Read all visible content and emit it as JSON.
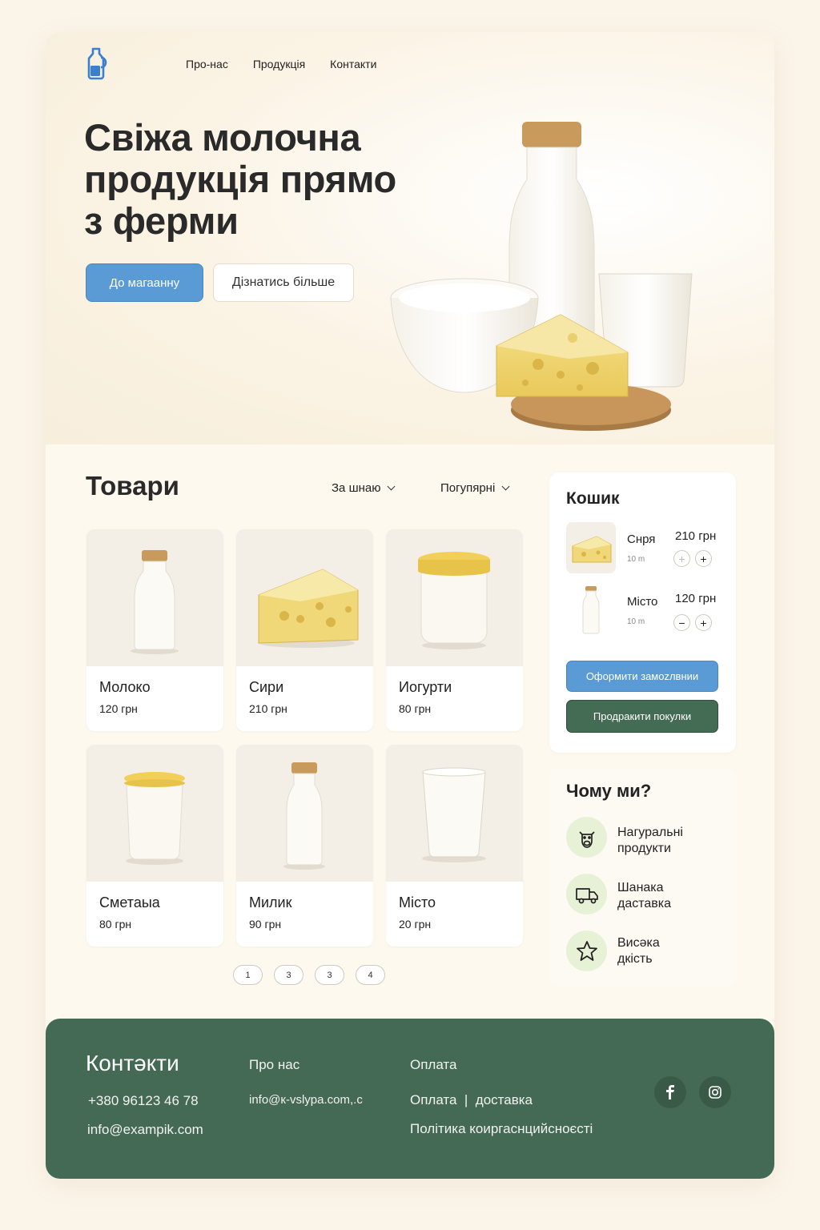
{
  "nav": {
    "items": [
      "Про-нас",
      "Продукція",
      "Контакти"
    ]
  },
  "hero": {
    "title_lines": [
      "Свіжа молочна",
      "продукція прямо",
      "з ферми"
    ],
    "primary_button": "До магаанну",
    "secondary_button": "Дізнатись більше"
  },
  "products": {
    "title": "Товари",
    "sort_price": "За шнаю",
    "sort_popular": "Погупярні",
    "items": [
      {
        "name": "Молоко",
        "price": "120 грн",
        "icon": "milk-bottle"
      },
      {
        "name": "Сири",
        "price": "210 грн",
        "icon": "cheese"
      },
      {
        "name": "Иогурти",
        "price": "80 грн",
        "icon": "yogurt-jar"
      },
      {
        "name": "Сметаыа",
        "price": "80 грн",
        "icon": "sour-cream-cup"
      },
      {
        "name": "Милик",
        "price": "90 грн",
        "icon": "milk-bottle"
      },
      {
        "name": "Місто",
        "price": "20 грн",
        "icon": "milk-glass"
      }
    ],
    "pages": [
      "1",
      "3",
      "3",
      "4"
    ]
  },
  "cart": {
    "title": "Кошик",
    "items": [
      {
        "name": "Снря",
        "sub": "10 m",
        "price": "210 грн",
        "icon": "cheese"
      },
      {
        "name": "Місто",
        "sub": "10 m",
        "price": "120 грн",
        "icon": "milk-bottle"
      }
    ],
    "checkout_button": "Оформити замоzлвнии",
    "continue_button": "Продракити покулки"
  },
  "why": {
    "title": "Чому ми?",
    "features": [
      {
        "line1": "Нагуральні",
        "line2": "продукти",
        "icon": "cow-icon"
      },
      {
        "line1": "Шанака",
        "line2": "даставка",
        "icon": "truck-icon"
      },
      {
        "line1": "Висәка",
        "line2": "дкість",
        "icon": "star-icon"
      }
    ]
  },
  "footer": {
    "title": "Контәкти",
    "phone": "+380 96123 46 78",
    "email": "info@exampik.com",
    "about": "Про нас",
    "about_email": "info@к-vslypa.com,.c",
    "payment": "Оплата",
    "payment_delivery": "Оплата  |  доставка",
    "privacy": "Політика коиргаснцийсноєсті"
  },
  "colors": {
    "accent_blue": "#5a9bd6",
    "accent_green": "#446b54",
    "background": "#fbf5e9"
  }
}
